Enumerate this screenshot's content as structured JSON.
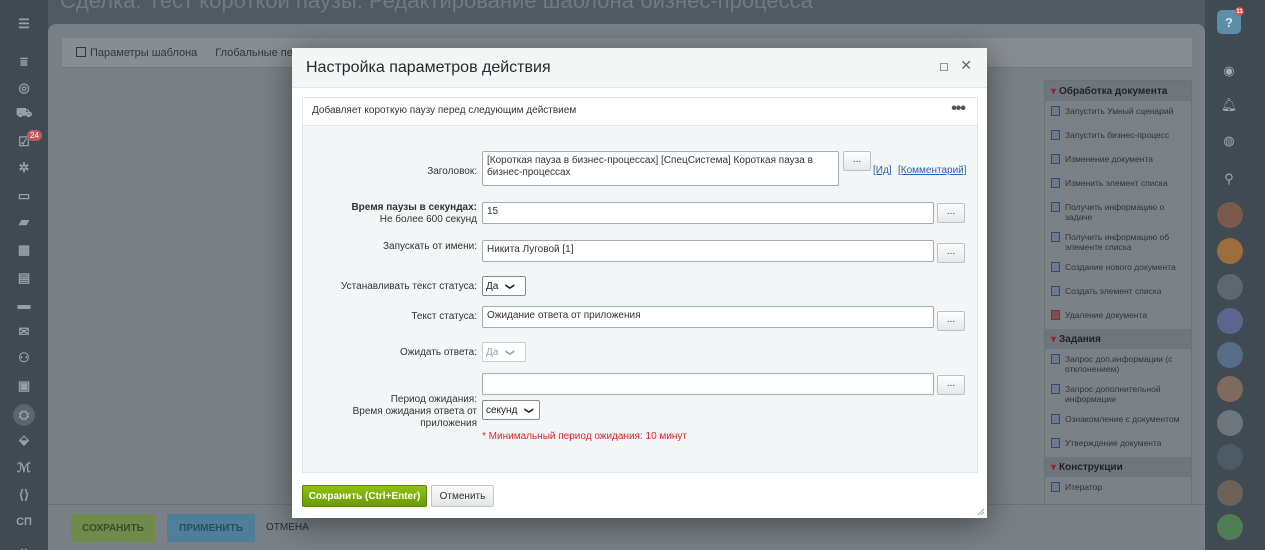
{
  "page": {
    "title": "Сделка: Тест короткой паузы: Редактирование шаблона бизнес-процесса"
  },
  "left_sidebar": {
    "badge": "24",
    "bottom_label": "СП"
  },
  "right_sidebar": {
    "help_label": "?",
    "help_badge": "11"
  },
  "editor": {
    "toolbar": {
      "template_params": "Параметры шаблона",
      "global_params": "Глобальные пе"
    },
    "palette": {
      "groups": [
        {
          "title": "Обработка документа",
          "items": [
            "Запустить Умный сценарий",
            "Запустить бизнес-процесс",
            "Изменение документа",
            "Изменить элемент списка",
            "Получить информацию о задаче",
            "Получить информацию об элементе списка",
            "Создание нового документа",
            "Создать элемент списка",
            "Удаление документа"
          ]
        },
        {
          "title": "Задания",
          "items": [
            "Запрос доп.информации (с отклонением)",
            "Запрос дополнительной информации",
            "Ознакомление с документом",
            "Утверждение документа"
          ]
        },
        {
          "title": "Конструкции",
          "items": [
            "Итератор"
          ]
        }
      ]
    },
    "bottom": {
      "save": "СОХРАНИТЬ",
      "apply": "ПРИМЕНИТЬ",
      "cancel": "ОТМЕНА"
    }
  },
  "dialog": {
    "title": "Настройка параметров действия",
    "description": "Добавляет короткую паузу перед следующим действием",
    "more_label": "•••",
    "fields": {
      "title_label": "Заголовок:",
      "title_value": "[Короткая пауза в бизнес-процессах] [СпецСистема] Короткая пауза в бизнес-процессах",
      "id_link": "[Ид]",
      "comment_link": "[Комментарий]",
      "pause_label_1": "Время паузы в секундах:",
      "pause_label_2": "Не более 600 секунд",
      "pause_value": "15",
      "run_as_label": "Запускать от имени:",
      "run_as_value": "Никита Луговой [1]",
      "set_status_label": "Устанавливать текст статуса:",
      "set_status_value": "Да",
      "status_text_label": "Текст статуса:",
      "status_text_value": "Ожидание ответа от приложения",
      "wait_answer_label": "Ожидать ответа:",
      "wait_answer_value": "Да",
      "period_label_1": "Период ожидания:",
      "period_label_2": "Время ожидания ответа от",
      "period_label_3": "приложения",
      "period_value": "",
      "period_unit": "секунд",
      "period_error": "* Минимальный период ожидания: 10 минут"
    },
    "dots_button": "...",
    "save_button": "Сохранить (Ctrl+Enter)",
    "cancel_button": "Отменить"
  }
}
